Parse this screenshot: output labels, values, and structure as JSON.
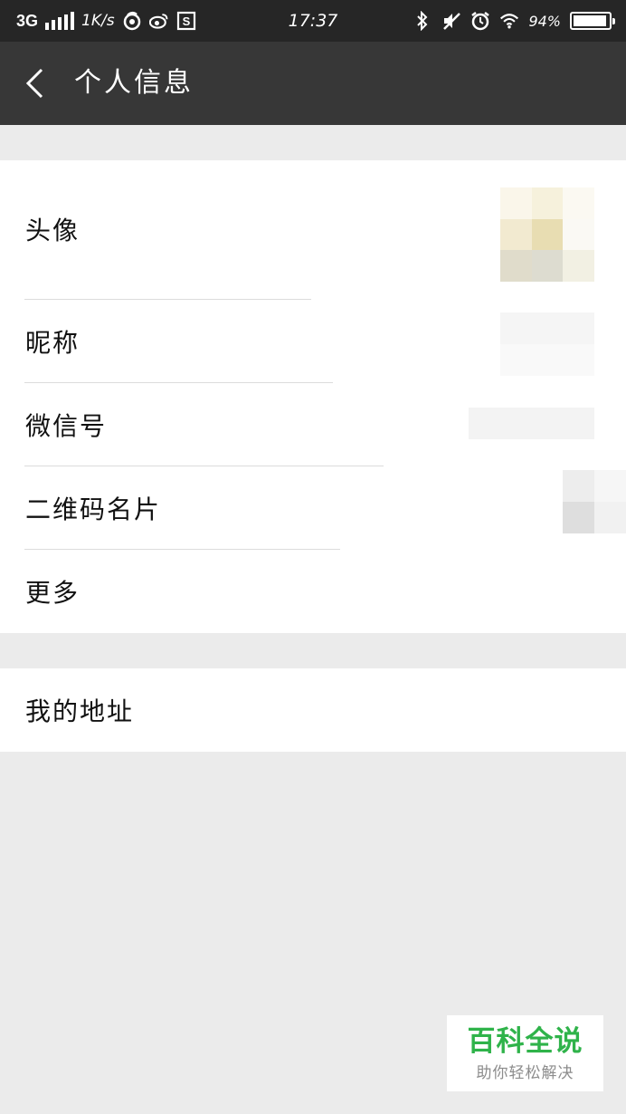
{
  "status_bar": {
    "network": "3G",
    "speed": "1K/s",
    "time": "17:37",
    "battery_text": "94%",
    "battery_level": 0.94,
    "icons": [
      "netease-icon",
      "weibo-icon",
      "s-app-icon",
      "bluetooth-icon",
      "mute-icon",
      "alarm-icon",
      "wifi-icon",
      "battery-icon"
    ]
  },
  "header": {
    "title": "个人信息",
    "back_icon": "chevron-left-icon"
  },
  "profile_group": {
    "items": [
      {
        "label": "头像"
      },
      {
        "label": "昵称"
      },
      {
        "label": "微信号"
      },
      {
        "label": "二维码名片"
      },
      {
        "label": "更多"
      }
    ]
  },
  "address_group": {
    "items": [
      {
        "label": "我的地址"
      }
    ]
  },
  "watermark": {
    "brand": "百科全说",
    "tagline": "助你轻松解决"
  },
  "colors": {
    "status_bar_bg": "#262626",
    "title_bar_bg": "#373737",
    "page_bg": "#ebebeb",
    "row_bg": "#ffffff",
    "watermark_green": "#2fb34a"
  }
}
